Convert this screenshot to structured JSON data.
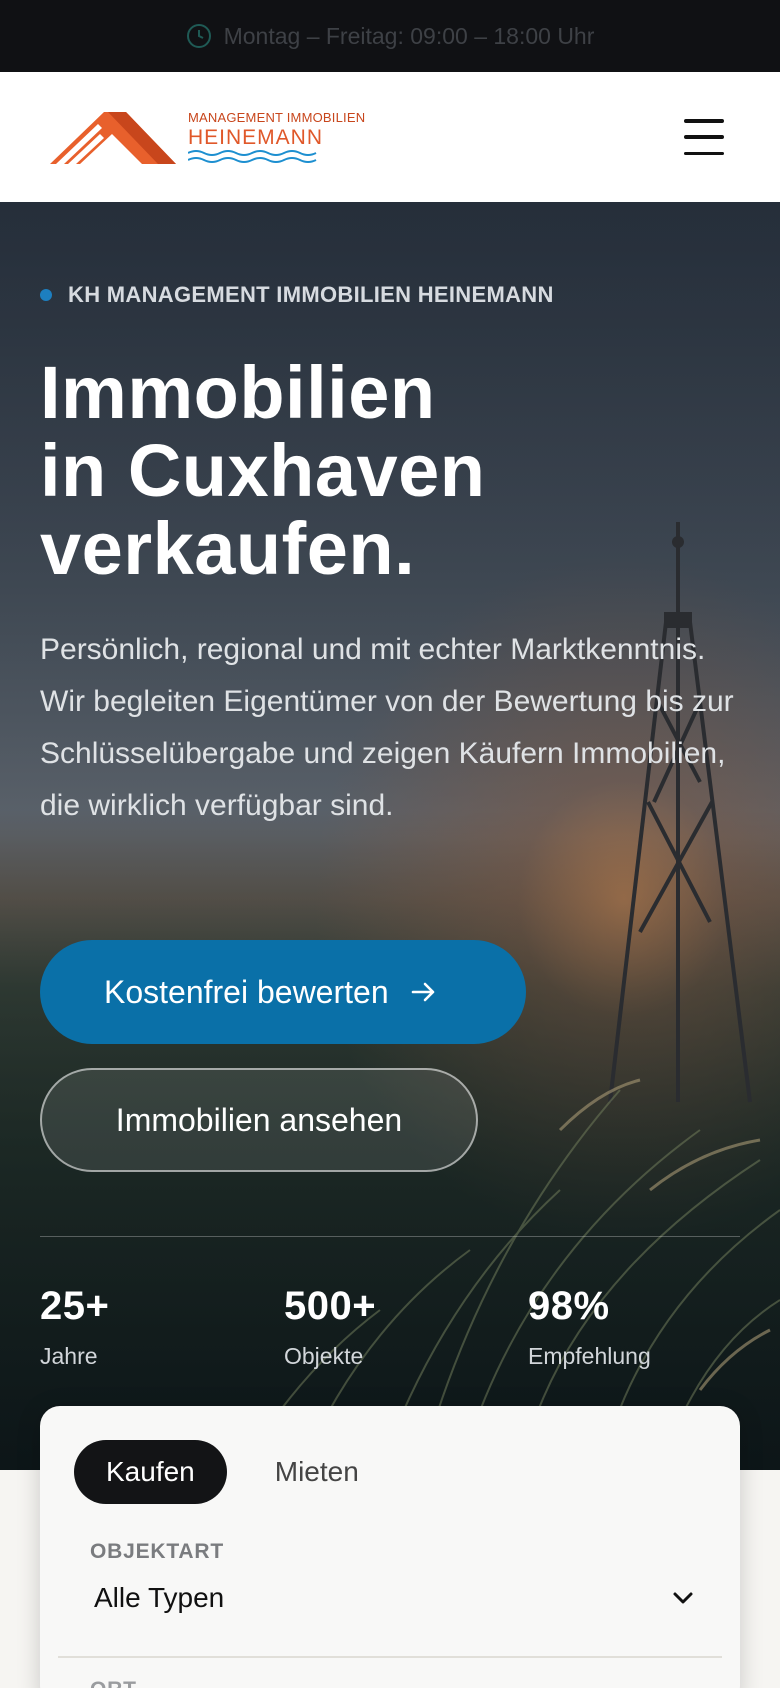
{
  "topbar": {
    "hours": "Montag – Freitag: 09:00 – 18:00 Uhr",
    "icon": "clock-icon"
  },
  "header": {
    "logo_small": "MANAGEMENT IMMOBILIEN",
    "logo_big": "HEINEMANN",
    "menu_icon": "hamburger-menu-icon",
    "brand_color": "#e0582a"
  },
  "hero": {
    "eyebrow": "KH MANAGEMENT IMMOBILIEN HEINEMANN",
    "headline": [
      "Immobilien",
      "in Cuxhaven",
      "verkaufen."
    ],
    "lead": "Persönlich, regional und mit echter Marktkenntnis. Wir begleiten Eigentümer von der Bewertung bis zur Schlüsselübergabe und zeigen Käufern Immobilien, die wirklich verfügbar sind.",
    "primary_cta": "Kostenfrei bewerten",
    "secondary_cta": "Immobilien ansehen",
    "accent_color": "#0a70a8"
  },
  "stats": [
    {
      "value": "25+",
      "label": "Jahre"
    },
    {
      "value": "500+",
      "label": "Objekte"
    },
    {
      "value": "98%",
      "label": "Empfehlung"
    }
  ],
  "search": {
    "tabs": [
      "Kaufen",
      "Mieten"
    ],
    "active_tab": "Kaufen",
    "type_label": "OBJEKTART",
    "type_value": "Alle Typen",
    "location_label": "ORT"
  }
}
